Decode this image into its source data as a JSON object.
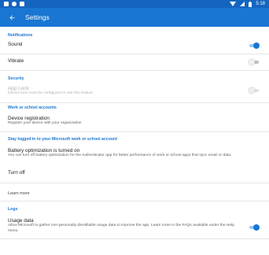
{
  "status_bar": {
    "time": "5:18"
  },
  "app_bar": {
    "title": "Settings"
  },
  "sections": {
    "notifications": {
      "header": "Notifications",
      "sound": {
        "label": "Sound",
        "enabled": true
      },
      "vibrate": {
        "label": "Vibrate",
        "enabled": false
      }
    },
    "security": {
      "header": "Security",
      "app_lock": {
        "label": "App Lock",
        "subtitle": "Device lock must be configured to use this feature",
        "enabled": false,
        "disabled": true
      }
    },
    "work_accounts": {
      "header": "Work or school accounts",
      "device_registration": {
        "label": "Device registration",
        "subtitle": "Register your device with your organization"
      }
    },
    "stay_logged_in": {
      "header": "Stay logged in to your Microsoft work or school account",
      "battery": {
        "label": "Battery optimization is turned on",
        "subtitle": "You can turn off battery optimization for the Authenticator app for better performance of work or school apps that sync email or data."
      },
      "turn_off": {
        "label": "Turn off"
      },
      "learn_more": {
        "label": "Learn more"
      }
    },
    "logs": {
      "header": "Logs",
      "usage_data": {
        "label": "Usage data",
        "subtitle": "Allow Microsoft to gather non-personally identifiable usage data to improve the app. Learn more in the FAQs available under the Help menu.",
        "enabled": true
      }
    }
  },
  "colors": {
    "accent": "#1976d2",
    "status_bar": "#1565c0",
    "toggle_on_track": "#90caf9",
    "toggle_off_track": "#bdbdbd"
  }
}
